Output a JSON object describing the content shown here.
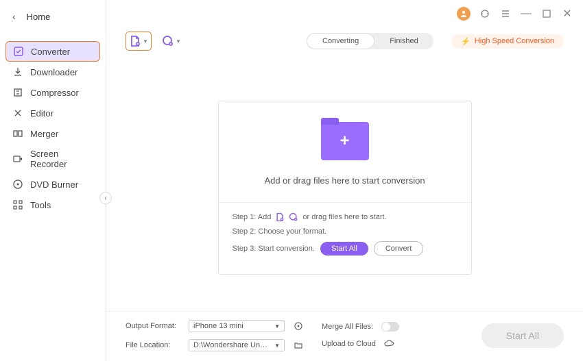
{
  "home": "Home",
  "sidebar": [
    {
      "label": "Converter"
    },
    {
      "label": "Downloader"
    },
    {
      "label": "Compressor"
    },
    {
      "label": "Editor"
    },
    {
      "label": "Merger"
    },
    {
      "label": "Screen Recorder"
    },
    {
      "label": "DVD Burner"
    },
    {
      "label": "Tools"
    }
  ],
  "tabs": {
    "converting": "Converting",
    "finished": "Finished"
  },
  "speed": "High Speed Conversion",
  "drop": {
    "msg": "Add or drag files here to start conversion",
    "s1a": "Step 1: Add",
    "s1b": "or drag files here to start.",
    "s2": "Step 2: Choose your format.",
    "s3": "Step 3: Start conversion.",
    "startall": "Start All",
    "convert": "Convert"
  },
  "footer": {
    "outlbl": "Output Format:",
    "outval": "iPhone 13 mini",
    "mergelbl": "Merge All Files:",
    "loclbl": "File Location:",
    "locval": "D:\\Wondershare UniConverter 1",
    "uploadlbl": "Upload to Cloud",
    "startall": "Start All"
  }
}
